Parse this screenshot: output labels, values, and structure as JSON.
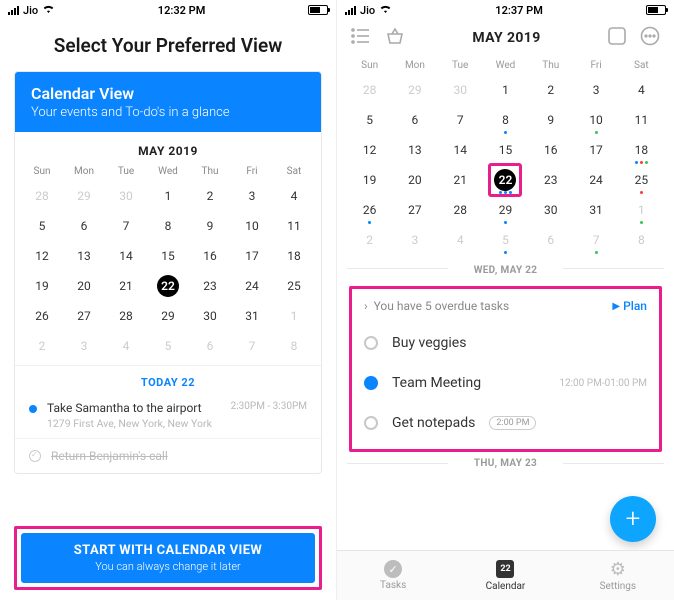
{
  "left": {
    "status": {
      "carrier": "Jio",
      "time": "12:32 PM"
    },
    "heading": "Select Your Preferred View",
    "card": {
      "title": "Calendar View",
      "subtitle": "Your events and To-do's in a glance"
    },
    "month_label": "MAY 2019",
    "dow": [
      "Sun",
      "Mon",
      "Tue",
      "Wed",
      "Thu",
      "Fri",
      "Sat"
    ],
    "weeks": [
      [
        {
          "n": "28",
          "dim": true
        },
        {
          "n": "29",
          "dim": true
        },
        {
          "n": "30",
          "dim": true
        },
        {
          "n": "1"
        },
        {
          "n": "2"
        },
        {
          "n": "3"
        },
        {
          "n": "4"
        }
      ],
      [
        {
          "n": "5"
        },
        {
          "n": "6"
        },
        {
          "n": "7"
        },
        {
          "n": "8"
        },
        {
          "n": "9"
        },
        {
          "n": "10"
        },
        {
          "n": "11"
        }
      ],
      [
        {
          "n": "12"
        },
        {
          "n": "13"
        },
        {
          "n": "14"
        },
        {
          "n": "15"
        },
        {
          "n": "16"
        },
        {
          "n": "17"
        },
        {
          "n": "18"
        }
      ],
      [
        {
          "n": "19"
        },
        {
          "n": "20"
        },
        {
          "n": "21"
        },
        {
          "n": "22",
          "today": true
        },
        {
          "n": "23"
        },
        {
          "n": "24"
        },
        {
          "n": "25"
        }
      ],
      [
        {
          "n": "26"
        },
        {
          "n": "27"
        },
        {
          "n": "28"
        },
        {
          "n": "29"
        },
        {
          "n": "30"
        },
        {
          "n": "31"
        },
        {
          "n": "1",
          "dim": true
        }
      ],
      [
        {
          "n": "2",
          "dim": true
        },
        {
          "n": "3",
          "dim": true
        },
        {
          "n": "4",
          "dim": true
        },
        {
          "n": "5",
          "dim": true
        },
        {
          "n": "6",
          "dim": true
        },
        {
          "n": "7",
          "dim": true
        },
        {
          "n": "8",
          "dim": true
        }
      ]
    ],
    "today_label": "TODAY 22",
    "event": {
      "title": "Take Samantha to the airport",
      "subtitle": "1279 First Ave, New York, New York",
      "time": "2:30PM - 3:30PM"
    },
    "completed_task": "Return Benjamin's call",
    "cta": {
      "title": "START WITH CALENDAR VIEW",
      "subtitle": "You can always change it later"
    }
  },
  "right": {
    "status": {
      "carrier": "Jio",
      "time": "12:37 PM"
    },
    "month_label": "MAY 2019",
    "dow": [
      "Sun",
      "Mon",
      "Tue",
      "Wed",
      "Thu",
      "Fri",
      "Sat"
    ],
    "weeks": [
      [
        {
          "n": "28",
          "dim": true
        },
        {
          "n": "29",
          "dim": true
        },
        {
          "n": "30",
          "dim": true
        },
        {
          "n": "1"
        },
        {
          "n": "2"
        },
        {
          "n": "3"
        },
        {
          "n": "4"
        }
      ],
      [
        {
          "n": "5"
        },
        {
          "n": "6"
        },
        {
          "n": "7"
        },
        {
          "n": "8",
          "dots": [
            "blue"
          ]
        },
        {
          "n": "9"
        },
        {
          "n": "10",
          "dots": [
            "green"
          ]
        },
        {
          "n": "11"
        }
      ],
      [
        {
          "n": "12"
        },
        {
          "n": "13"
        },
        {
          "n": "14"
        },
        {
          "n": "15"
        },
        {
          "n": "16"
        },
        {
          "n": "17"
        },
        {
          "n": "18",
          "dots": [
            "blue",
            "red",
            "green"
          ]
        }
      ],
      [
        {
          "n": "19"
        },
        {
          "n": "20"
        },
        {
          "n": "21"
        },
        {
          "n": "22",
          "today": true,
          "dots": [
            "blue",
            "blue",
            "blue"
          ]
        },
        {
          "n": "23"
        },
        {
          "n": "24"
        },
        {
          "n": "25",
          "dots": [
            "red"
          ]
        }
      ],
      [
        {
          "n": "26",
          "dots": [
            "blue"
          ]
        },
        {
          "n": "27"
        },
        {
          "n": "28"
        },
        {
          "n": "29",
          "dots": [
            "blue"
          ]
        },
        {
          "n": "30"
        },
        {
          "n": "31"
        },
        {
          "n": "1",
          "dim": true,
          "dots": [
            "green"
          ]
        }
      ],
      [
        {
          "n": "2",
          "dim": true
        },
        {
          "n": "3",
          "dim": true
        },
        {
          "n": "4",
          "dim": true
        },
        {
          "n": "5",
          "dim": true,
          "dots": [
            "blue"
          ]
        },
        {
          "n": "6",
          "dim": true
        },
        {
          "n": "7",
          "dim": true,
          "dots": [
            "green"
          ]
        },
        {
          "n": "8",
          "dim": true
        }
      ]
    ],
    "section1": "WED, MAY 22",
    "overdue_label": "You have 5 overdue tasks",
    "plan_label": "Plan",
    "tasks": [
      {
        "title": "Buy veggies",
        "state": "open"
      },
      {
        "title": "Team Meeting",
        "state": "active",
        "time": "12:00 PM-01:00 PM"
      },
      {
        "title": "Get notepads",
        "state": "open",
        "chip": "2:00 PM"
      }
    ],
    "section2": "THU, MAY 23",
    "tabs": {
      "tasks": "Tasks",
      "calendar": "Calendar",
      "cal_day": "22",
      "settings": "Settings"
    }
  }
}
